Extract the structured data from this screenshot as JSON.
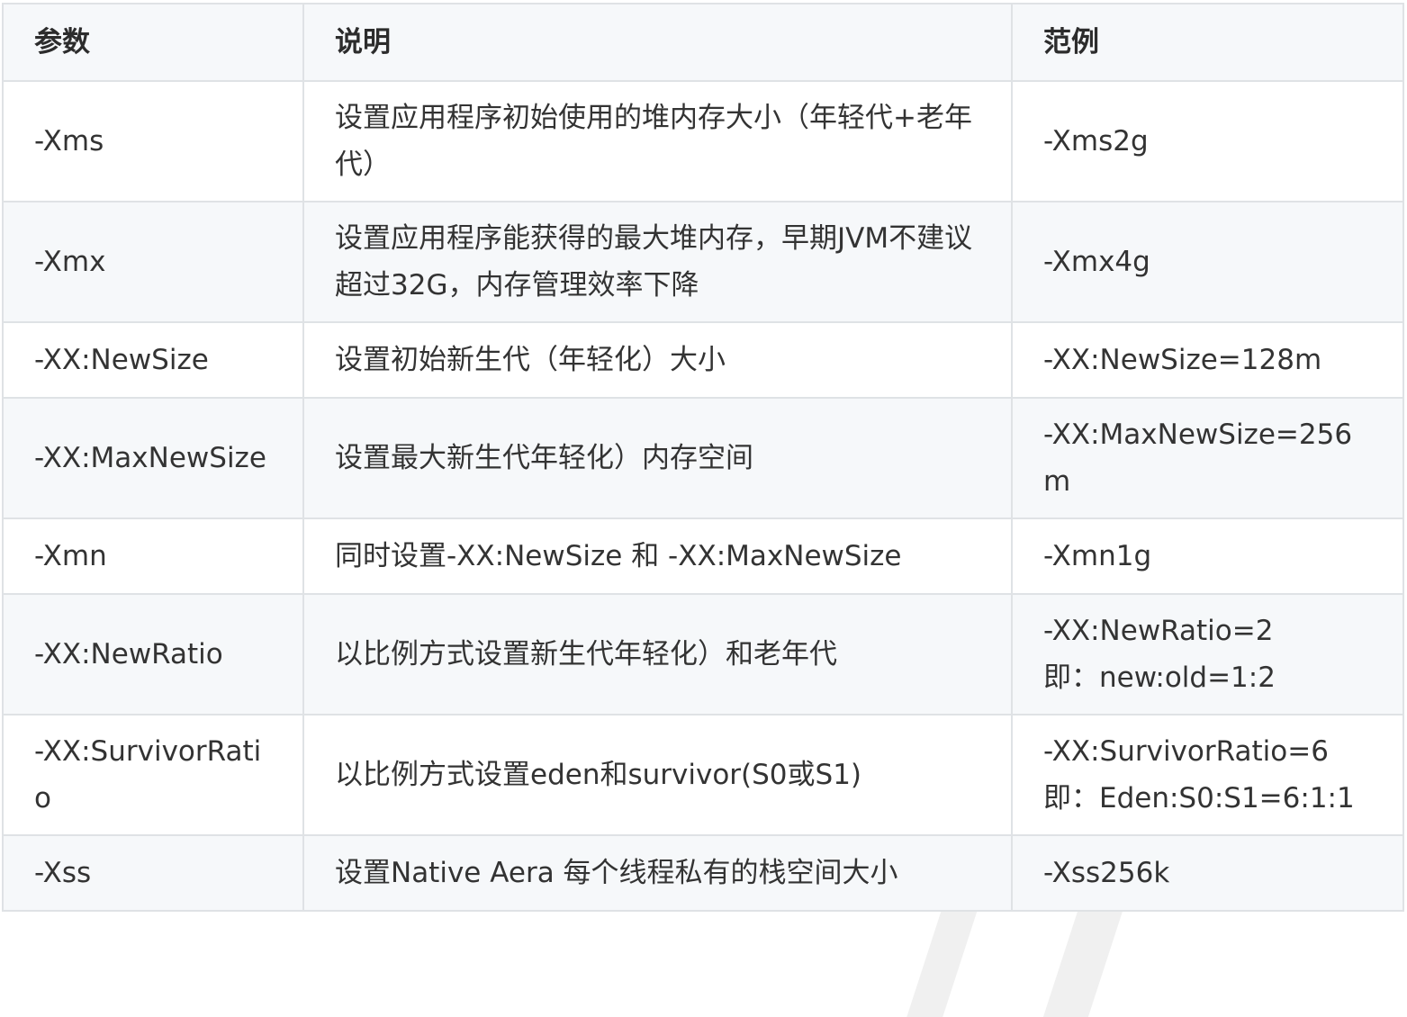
{
  "table": {
    "headers": [
      "参数",
      "说明",
      "范例"
    ],
    "rows": [
      {
        "param": "-Xms",
        "desc": "设置应用程序初始使用的堆内存大小（年轻代+老年代）",
        "example": "-Xms2g",
        "size": "two"
      },
      {
        "param": "-Xmx",
        "desc": "设置应用程序能获得的最大堆内存，早期JVM不建议超过32G，内存管理效率下降",
        "example": "-Xmx4g",
        "size": "two"
      },
      {
        "param": "-XX:NewSize",
        "desc": "设置初始新生代（年轻化）大小",
        "example": "-XX:NewSize=128m",
        "size": "one"
      },
      {
        "param": "-XX:MaxNewSize",
        "desc": "设置最大新生代年轻化）内存空间",
        "example": "-XX:MaxNewSize=256m",
        "size": "two"
      },
      {
        "param": "-Xmn",
        "desc": "同时设置-XX:NewSize 和 -XX:MaxNewSize",
        "example": "-Xmn1g",
        "size": "one"
      },
      {
        "param": "-XX:NewRatio",
        "desc": "以比例方式设置新生代年轻化）和老年代",
        "example_lines": [
          "-XX:NewRatio=2",
          "即：new:old=1:2"
        ],
        "size": "two"
      },
      {
        "param": "-XX:SurvivorRatio",
        "desc": "以比例方式设置eden和survivor(S0或S1)",
        "example_lines": [
          "-XX:SurvivorRatio=6",
          "即：Eden:S0:S1=6:1:1"
        ],
        "size": "two"
      },
      {
        "param": "-Xss",
        "desc": "设置Native Aera 每个线程私有的栈空间大小",
        "example": "-Xss256k",
        "size": "one"
      }
    ]
  }
}
